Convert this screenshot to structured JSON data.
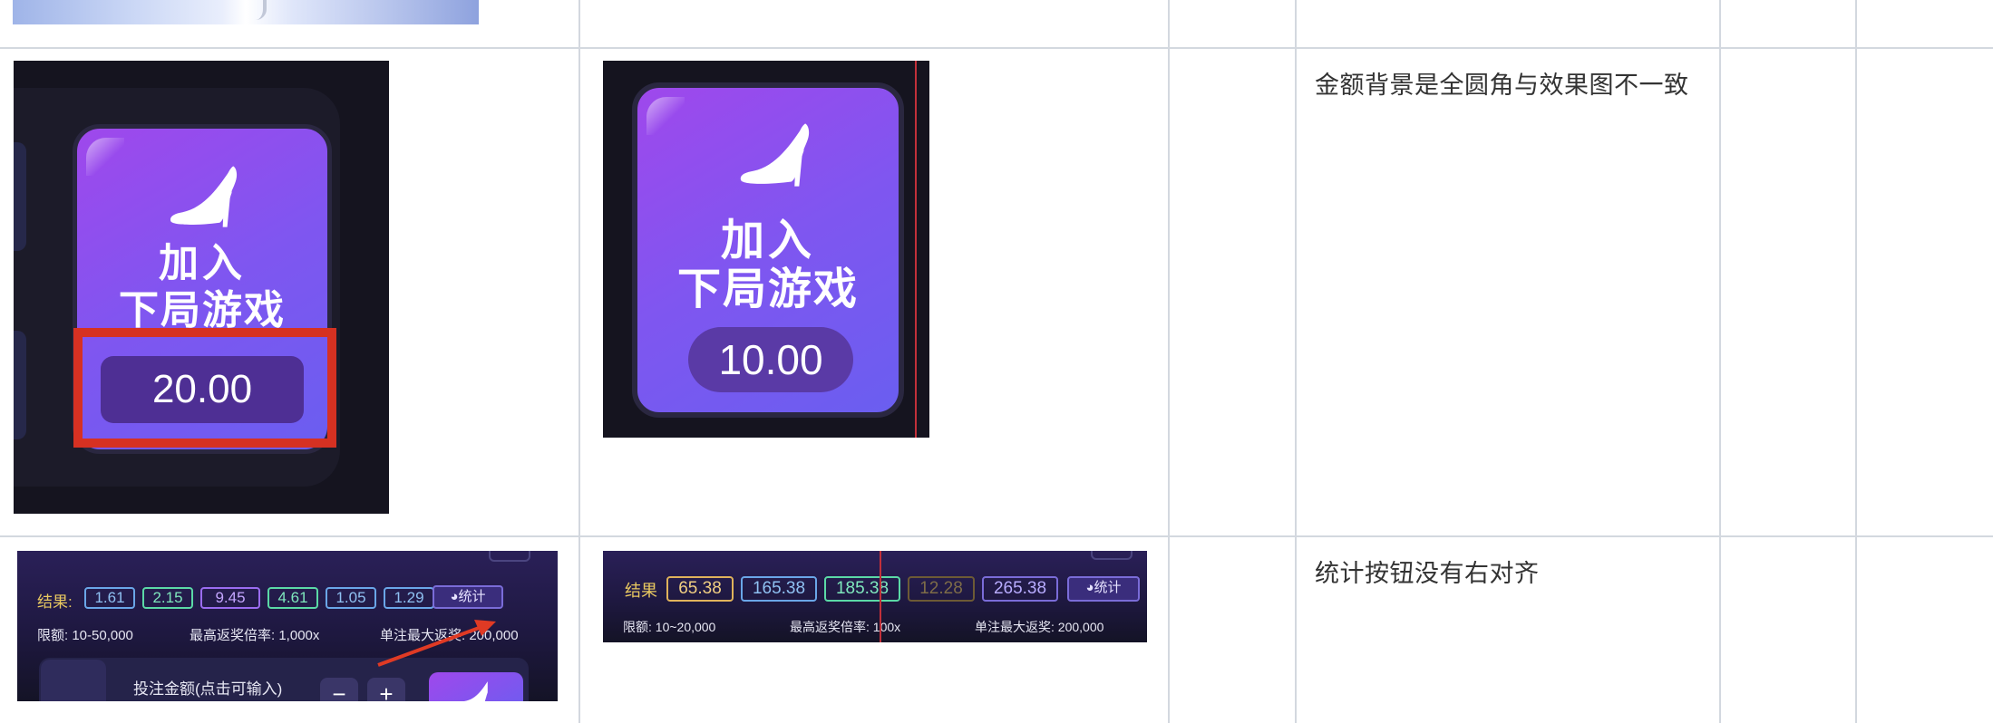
{
  "rows": [
    {
      "annotated": {
        "label": "加入",
        "label2": "下局游戏",
        "amount": "20.00"
      },
      "expected": {
        "label": "加入",
        "label2": "下局游戏",
        "amount": "10.00"
      },
      "note": "金额背景是全圆角与效果图不一致"
    },
    {
      "annotated": {
        "results_label": "结果:",
        "results": [
          "1.61",
          "2.15",
          "9.45",
          "4.61",
          "1.05",
          "1.29"
        ],
        "stat_button": "统计",
        "limit": "限额: 10-50,000",
        "max_odds": "最高返奖倍率: 1,000x",
        "max_payout": "单注最大返奖: 200,000",
        "bet_label": "投注金额(点击可输入)",
        "minus": "−",
        "plus": "+"
      },
      "expected": {
        "results_label": "结果",
        "results": [
          "65.38",
          "165.38",
          "185.38",
          "12.28",
          "265.38"
        ],
        "stat_button": "统计",
        "limit": "限额: 10~20,000",
        "max_odds": "最高返奖倍率: 100x",
        "max_payout": "单注最大返奖: 200,000"
      },
      "note": "统计按钮没有右对齐"
    }
  ],
  "colors": {
    "grid": "#d3d8df",
    "card_purple_start": "#9f48ec",
    "card_purple_end": "#6a5ef0",
    "highlight_red": "#d63122",
    "arrow_red": "#e03a24",
    "chip_blue": "#6aa6e8",
    "chip_green": "#5bd9a6",
    "chip_gold": "#e0b35b"
  }
}
